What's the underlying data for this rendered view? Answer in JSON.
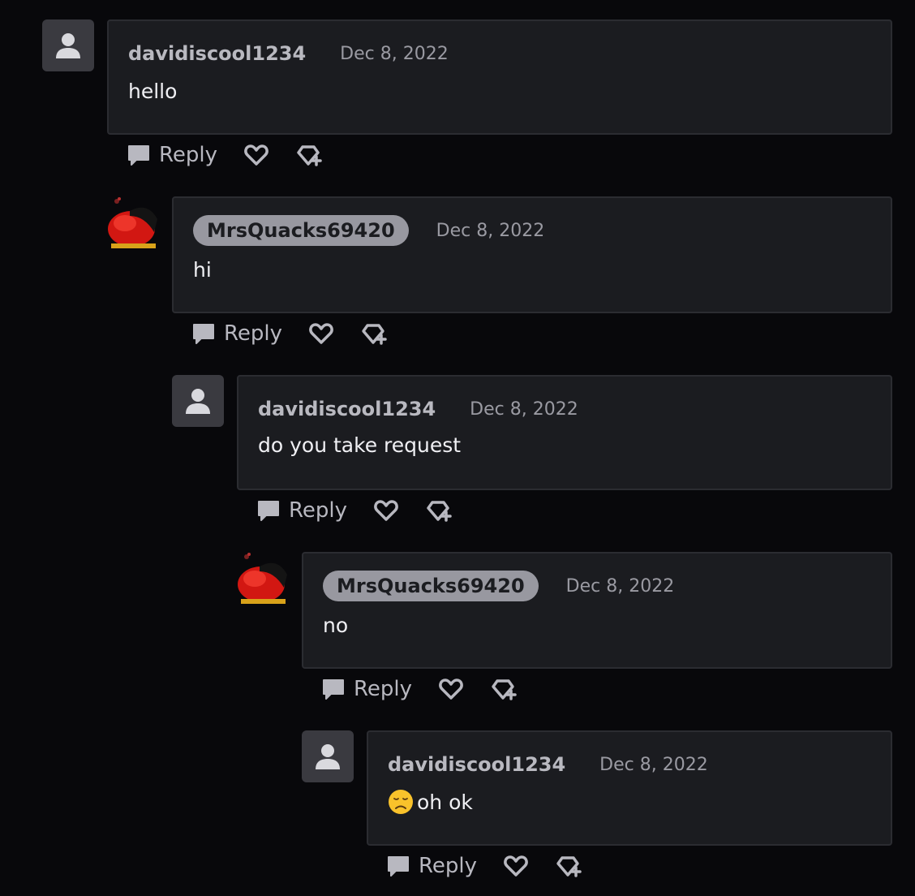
{
  "comments": [
    {
      "username": "davidiscool1234",
      "date": "Dec 8, 2022",
      "text": "hello",
      "avatar": "default-user-icon",
      "highlighted": false
    },
    {
      "username": "MrsQuacks69420",
      "date": "Dec 8, 2022",
      "text": "hi",
      "avatar": "custom-red-avatar",
      "highlighted": true
    },
    {
      "username": "davidiscool1234",
      "date": "Dec 8, 2022",
      "text": "do you take request",
      "avatar": "default-user-icon",
      "highlighted": false
    },
    {
      "username": "MrsQuacks69420",
      "date": "Dec 8, 2022",
      "text": "no",
      "avatar": "custom-red-avatar",
      "highlighted": true
    },
    {
      "username": "davidiscool1234",
      "date": "Dec 8, 2022",
      "text": "oh ok",
      "emoji": "disappointed-face-icon",
      "avatar": "default-user-icon",
      "highlighted": false
    }
  ],
  "actions": {
    "reply_label": "Reply",
    "like_icon": "heart-icon",
    "gift_icon": "gem-plus-icon"
  },
  "colors": {
    "background": "#08080b",
    "bubble": "#1b1c20",
    "border": "#2b2c31",
    "pill": "#9898a0",
    "muted": "#9a9aa2",
    "avatar_red": "#d21712"
  }
}
